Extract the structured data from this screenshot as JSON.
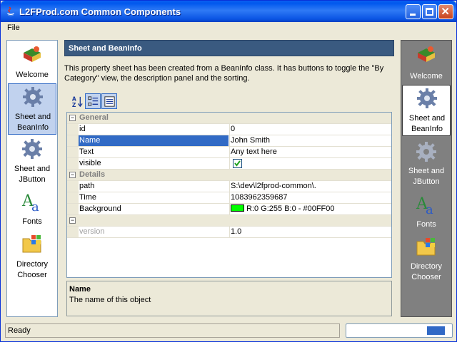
{
  "window": {
    "title": "L2FProd.com Common Components"
  },
  "menu": {
    "items": [
      "File"
    ]
  },
  "nav_left": [
    {
      "label": "Welcome",
      "icon": "book-icon",
      "selected": false
    },
    {
      "label": "Sheet and BeanInfo",
      "icon": "gear-icon",
      "selected": true
    },
    {
      "label": "Sheet and JButton",
      "icon": "gear-icon",
      "selected": false
    },
    {
      "label": "Fonts",
      "icon": "font-icon",
      "selected": false
    },
    {
      "label": "Directory Chooser",
      "icon": "folder-icon",
      "selected": false
    }
  ],
  "nav_right": [
    {
      "label": "Welcome",
      "icon": "book-icon",
      "selected": false
    },
    {
      "label": "Sheet and BeanInfo",
      "icon": "gear-icon",
      "selected": true
    },
    {
      "label": "Sheet and JButton",
      "icon": "gear-icon",
      "selected": false
    },
    {
      "label": "Fonts",
      "icon": "font-icon",
      "selected": false
    },
    {
      "label": "Directory Chooser",
      "icon": "folder-icon",
      "selected": false
    }
  ],
  "panel": {
    "title": "Sheet and BeanInfo",
    "description": "This property sheet has been created from a BeanInfo class. It has buttons to toggle the \"By Category\" view, the description panel and the sorting."
  },
  "toolbar": {
    "buttons": [
      {
        "name": "sort-az-icon",
        "pressed": false
      },
      {
        "name": "category-view-icon",
        "pressed": true
      },
      {
        "name": "description-panel-icon",
        "pressed": true
      }
    ]
  },
  "sheet": {
    "categories": [
      {
        "name": "General",
        "props": [
          {
            "name": "id",
            "value": "0"
          },
          {
            "name": "Name",
            "value": "John Smith",
            "selected": true
          },
          {
            "name": "Text",
            "value": "Any text here"
          },
          {
            "name": "visible",
            "value": "",
            "checkbox": true,
            "checked": true
          }
        ]
      },
      {
        "name": "Details",
        "props": [
          {
            "name": "path",
            "value": "S:\\dev\\l2fprod-common\\."
          },
          {
            "name": "Time",
            "value": "1083962359687"
          },
          {
            "name": "Background",
            "value": "R:0 G:255 B:0 - #00FF00",
            "swatch": "#00ff00"
          }
        ]
      },
      {
        "name": "",
        "props": [
          {
            "name": "version",
            "value": "1.0",
            "disabled": true
          }
        ]
      }
    ]
  },
  "description_panel": {
    "title": "Name",
    "text": "The name of this object"
  },
  "status": {
    "text": "Ready",
    "progress": 0.2
  },
  "colors": {
    "title_bar": "#0058ee",
    "selection": "#316ac5",
    "header": "#3a5a80",
    "nav_right_bg": "#808080"
  }
}
